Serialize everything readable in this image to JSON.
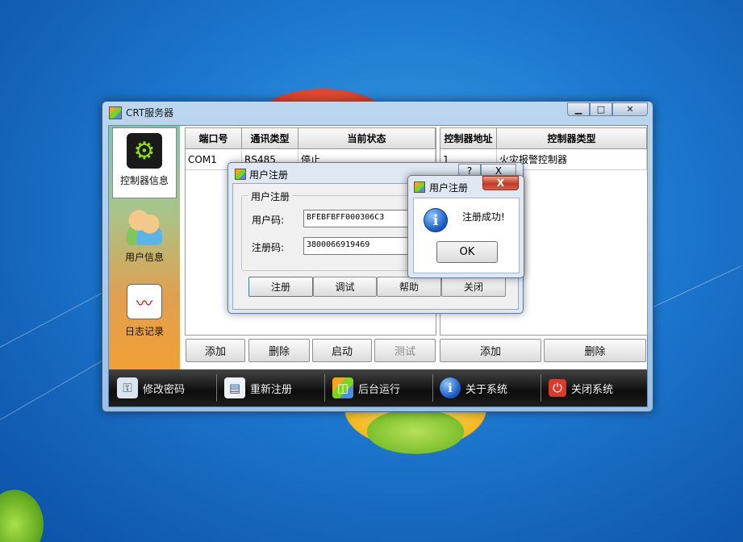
{
  "main_window": {
    "title": "CRT服务器",
    "icon": "cube-icon"
  },
  "sidebar": {
    "items": [
      {
        "label": "控制器信息",
        "icon": "gear-icon"
      },
      {
        "label": "用户信息",
        "icon": "users-icon"
      },
      {
        "label": "日志记录",
        "icon": "chart-log-icon"
      }
    ]
  },
  "ports_table": {
    "headers": [
      "端口号",
      "通讯类型",
      "当前状态"
    ],
    "rows": [
      [
        "COM1",
        "RS485",
        "停止"
      ]
    ],
    "buttons": {
      "add": "添加",
      "delete": "删除",
      "start": "启动",
      "test": "测试"
    }
  },
  "controllers_table": {
    "headers": [
      "控制器地址",
      "控制器类型"
    ],
    "rows": [
      [
        "1",
        "火灾报警控制器"
      ]
    ],
    "buttons": {
      "add": "添加",
      "delete": "删除"
    }
  },
  "toolbar": {
    "items": [
      {
        "label": "修改密码",
        "icon": "key-icon"
      },
      {
        "label": "重新注册",
        "icon": "register-card-icon"
      },
      {
        "label": "后台运行",
        "icon": "background-run-icon"
      },
      {
        "label": "关于系统",
        "icon": "info-icon"
      },
      {
        "label": "关闭系统",
        "icon": "power-icon"
      }
    ]
  },
  "register_dialog": {
    "title": "用户注册",
    "help_label": "?",
    "close_label": "X",
    "group_title": "用户注册",
    "user_code_label": "用户码:",
    "user_code_value": "BFEBFBFF000306C3",
    "reg_code_label": "注册码:",
    "reg_code_value": "3800066919469",
    "buttons": {
      "register": "注册",
      "debug": "调试",
      "help": "帮助",
      "close": "关闭"
    }
  },
  "message_box": {
    "title": "用户注册",
    "close_label": "X",
    "message": "注册成功!",
    "ok_label": "OK",
    "icon": "info-icon"
  }
}
